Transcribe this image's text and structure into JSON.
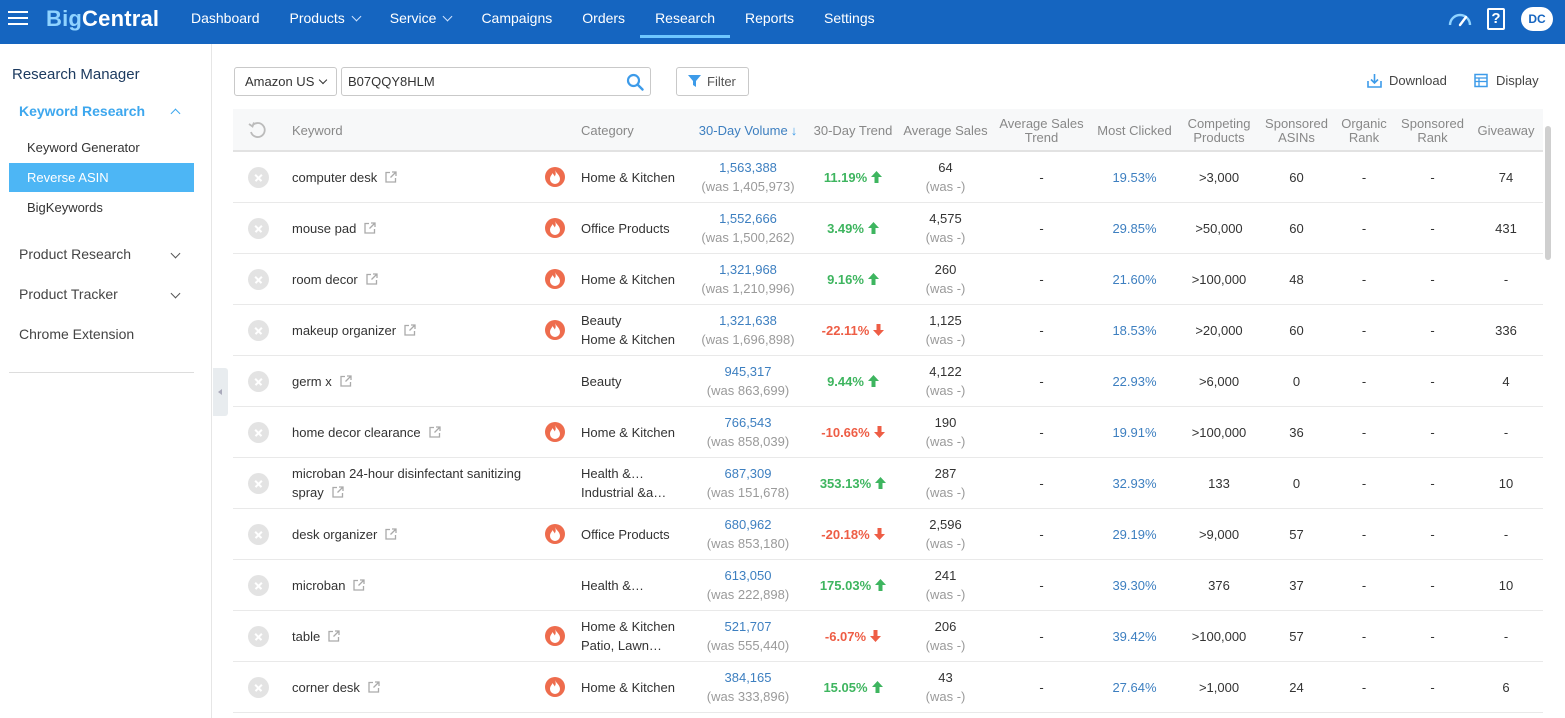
{
  "app": {
    "logo_prefix": "Big",
    "logo_suffix": "Central",
    "nav": [
      {
        "label": "Dashboard",
        "dropdown": false,
        "active": false
      },
      {
        "label": "Products",
        "dropdown": true,
        "active": false
      },
      {
        "label": "Service",
        "dropdown": true,
        "active": false
      },
      {
        "label": "Campaigns",
        "dropdown": false,
        "active": false
      },
      {
        "label": "Orders",
        "dropdown": false,
        "active": false
      },
      {
        "label": "Research",
        "dropdown": false,
        "active": true
      },
      {
        "label": "Reports",
        "dropdown": false,
        "active": false
      },
      {
        "label": "Settings",
        "dropdown": false,
        "active": false
      }
    ],
    "help_glyph": "?",
    "user_initials": "DC",
    "colors": {
      "topbar": "#1565c0",
      "accent": "#4db6f5",
      "link": "#3d7fc0",
      "up": "#3eb55f",
      "down": "#ee5d45",
      "hot": "#ee6c4d"
    }
  },
  "sidebar": {
    "title": "Research Manager",
    "keyword_research": "Keyword Research",
    "sub_items": [
      "Keyword Generator",
      "Reverse ASIN",
      "BigKeywords"
    ],
    "active_sub": "Reverse ASIN",
    "groups": [
      "Product Research",
      "Product Tracker"
    ],
    "chrome_extension": "Chrome Extension"
  },
  "toolbar": {
    "marketplace": "Amazon US",
    "search_value": "B07QQY8HLM",
    "filter_label": "Filter",
    "download_label": "Download",
    "display_label": "Display"
  },
  "table": {
    "headers": {
      "keyword": "Keyword",
      "category": "Category",
      "volume": "30-Day Volume",
      "trend": "30-Day Trend",
      "avg_sales": "Average Sales",
      "avg_sales_trend": [
        "Average Sales",
        "Trend"
      ],
      "most_clicked": "Most Clicked",
      "competing": [
        "Competing",
        "Products"
      ],
      "sponsored_asins": [
        "Sponsored",
        "ASINs"
      ],
      "organic_rank": [
        "Organic",
        "Rank"
      ],
      "sponsored_rank": [
        "Sponsored",
        "Rank"
      ],
      "giveaway": "Giveaway"
    },
    "sort_arrow": "↓",
    "rows": [
      {
        "keyword": [
          "computer desk"
        ],
        "hot": true,
        "category": [
          "Home & Kitchen"
        ],
        "volume": "1,563,388",
        "volume_was": "(was 1,405,973)",
        "trend": "11.19%",
        "trend_dir": "up",
        "sales": "64",
        "sales_was": "(was -)",
        "sales_trend": "-",
        "clicked": "19.53%",
        "competing": ">3,000",
        "sp_asins": "60",
        "organic": "-",
        "sp_rank": "-",
        "giveaway": "74"
      },
      {
        "keyword": [
          "mouse pad"
        ],
        "hot": true,
        "category": [
          "Office Products"
        ],
        "volume": "1,552,666",
        "volume_was": "(was 1,500,262)",
        "trend": "3.49%",
        "trend_dir": "up",
        "sales": "4,575",
        "sales_was": "(was -)",
        "sales_trend": "-",
        "clicked": "29.85%",
        "competing": ">50,000",
        "sp_asins": "60",
        "organic": "-",
        "sp_rank": "-",
        "giveaway": "431"
      },
      {
        "keyword": [
          "room decor"
        ],
        "hot": true,
        "category": [
          "Home & Kitchen"
        ],
        "volume": "1,321,968",
        "volume_was": "(was 1,210,996)",
        "trend": "9.16%",
        "trend_dir": "up",
        "sales": "260",
        "sales_was": "(was -)",
        "sales_trend": "-",
        "clicked": "21.60%",
        "competing": ">100,000",
        "sp_asins": "48",
        "organic": "-",
        "sp_rank": "-",
        "giveaway": "-"
      },
      {
        "keyword": [
          "makeup organizer"
        ],
        "hot": true,
        "category": [
          "Beauty",
          "Home & Kitchen"
        ],
        "volume": "1,321,638",
        "volume_was": "(was 1,696,898)",
        "trend": "-22.11%",
        "trend_dir": "down",
        "sales": "1,125",
        "sales_was": "(was -)",
        "sales_trend": "-",
        "clicked": "18.53%",
        "competing": ">20,000",
        "sp_asins": "60",
        "organic": "-",
        "sp_rank": "-",
        "giveaway": "336"
      },
      {
        "keyword": [
          "germ x"
        ],
        "hot": false,
        "category": [
          "Beauty"
        ],
        "volume": "945,317",
        "volume_was": "(was 863,699)",
        "trend": "9.44%",
        "trend_dir": "up",
        "sales": "4,122",
        "sales_was": "(was -)",
        "sales_trend": "-",
        "clicked": "22.93%",
        "competing": ">6,000",
        "sp_asins": "0",
        "organic": "-",
        "sp_rank": "-",
        "giveaway": "4"
      },
      {
        "keyword": [
          "home decor clearance"
        ],
        "hot": true,
        "category": [
          "Home & Kitchen"
        ],
        "volume": "766,543",
        "volume_was": "(was 858,039)",
        "trend": "-10.66%",
        "trend_dir": "down",
        "sales": "190",
        "sales_was": "(was -)",
        "sales_trend": "-",
        "clicked": "19.91%",
        "competing": ">100,000",
        "sp_asins": "36",
        "organic": "-",
        "sp_rank": "-",
        "giveaway": "-"
      },
      {
        "keyword": [
          "microban 24-hour disinfectant sanitizing",
          "spray"
        ],
        "hot": false,
        "category": [
          "Health &…",
          "Industrial &a…"
        ],
        "volume": "687,309",
        "volume_was": "(was 151,678)",
        "trend": "353.13%",
        "trend_dir": "up",
        "sales": "287",
        "sales_was": "(was -)",
        "sales_trend": "-",
        "clicked": "32.93%",
        "competing": "133",
        "sp_asins": "0",
        "organic": "-",
        "sp_rank": "-",
        "giveaway": "10"
      },
      {
        "keyword": [
          "desk organizer"
        ],
        "hot": true,
        "category": [
          "Office Products"
        ],
        "volume": "680,962",
        "volume_was": "(was 853,180)",
        "trend": "-20.18%",
        "trend_dir": "down",
        "sales": "2,596",
        "sales_was": "(was -)",
        "sales_trend": "-",
        "clicked": "29.19%",
        "competing": ">9,000",
        "sp_asins": "57",
        "organic": "-",
        "sp_rank": "-",
        "giveaway": "-"
      },
      {
        "keyword": [
          "microban"
        ],
        "hot": false,
        "category": [
          "Health &…"
        ],
        "volume": "613,050",
        "volume_was": "(was 222,898)",
        "trend": "175.03%",
        "trend_dir": "up",
        "sales": "241",
        "sales_was": "(was -)",
        "sales_trend": "-",
        "clicked": "39.30%",
        "competing": "376",
        "sp_asins": "37",
        "organic": "-",
        "sp_rank": "-",
        "giveaway": "10"
      },
      {
        "keyword": [
          "table"
        ],
        "hot": true,
        "category": [
          "Home & Kitchen",
          "Patio, Lawn…"
        ],
        "volume": "521,707",
        "volume_was": "(was 555,440)",
        "trend": "-6.07%",
        "trend_dir": "down",
        "sales": "206",
        "sales_was": "(was -)",
        "sales_trend": "-",
        "clicked": "39.42%",
        "competing": ">100,000",
        "sp_asins": "57",
        "organic": "-",
        "sp_rank": "-",
        "giveaway": "-"
      },
      {
        "keyword": [
          "corner desk"
        ],
        "hot": true,
        "category": [
          "Home & Kitchen"
        ],
        "volume": "384,165",
        "volume_was": "(was 333,896)",
        "trend": "15.05%",
        "trend_dir": "up",
        "sales": "43",
        "sales_was": "(was -)",
        "sales_trend": "-",
        "clicked": "27.64%",
        "competing": ">1,000",
        "sp_asins": "24",
        "organic": "-",
        "sp_rank": "-",
        "giveaway": "6"
      }
    ]
  }
}
